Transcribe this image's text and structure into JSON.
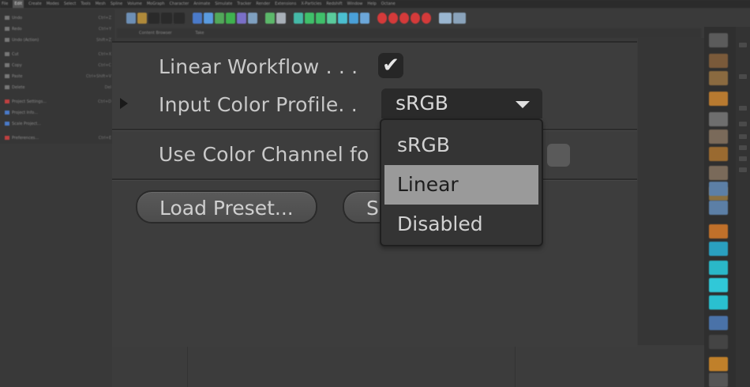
{
  "menubar": {
    "items": [
      "File",
      "Edit",
      "Create",
      "Modes",
      "Select",
      "Tools",
      "Mesh",
      "Spline",
      "Volume",
      "MoGraph",
      "Character",
      "Animate",
      "Simulate",
      "Tracker",
      "Render",
      "Extensions",
      "X-Particles",
      "Redshift",
      "Window",
      "Help",
      "Octane"
    ]
  },
  "edit_menu": {
    "items": [
      {
        "label": "Undo",
        "shortcut": "Ctrl+Z"
      },
      {
        "label": "Redo",
        "shortcut": "Ctrl+Y"
      },
      {
        "label": "Undo (Action)",
        "shortcut": "Shift+Z"
      },
      {
        "label": "Cut",
        "shortcut": "Ctrl+X"
      },
      {
        "label": "Copy",
        "shortcut": "Ctrl+C"
      },
      {
        "label": "Paste",
        "shortcut": "Ctrl+Shift+V"
      },
      {
        "label": "Delete",
        "shortcut": "Del"
      },
      {
        "label": "Project Settings...",
        "shortcut": "Ctrl+D"
      },
      {
        "label": "Project Info...",
        "shortcut": ""
      },
      {
        "label": "Scale Project...",
        "shortcut": ""
      },
      {
        "label": "Preferences...",
        "shortcut": "Ctrl+E"
      }
    ]
  },
  "tabs": {
    "items": [
      "Content Browser",
      "Take"
    ]
  },
  "settings": {
    "linear_workflow_label": "Linear Workflow . . .",
    "linear_workflow_checked": true,
    "input_color_profile_label": "Input Color Profile. .",
    "input_color_profile_value": "sRGB",
    "use_color_channel_label": "Use Color Channel fo",
    "use_color_channel_checked": false,
    "checkmark_glyph": "✔"
  },
  "dropdown": {
    "options": [
      "sRGB",
      "Linear",
      "Disabled"
    ],
    "highlighted": "Linear"
  },
  "buttons": {
    "load_preset": "Load Preset...",
    "save_preset": "Save Preset..."
  },
  "colors": {
    "panel_bg": "#3d3d3d",
    "dropdown_highlight": "#9a9a9a"
  }
}
